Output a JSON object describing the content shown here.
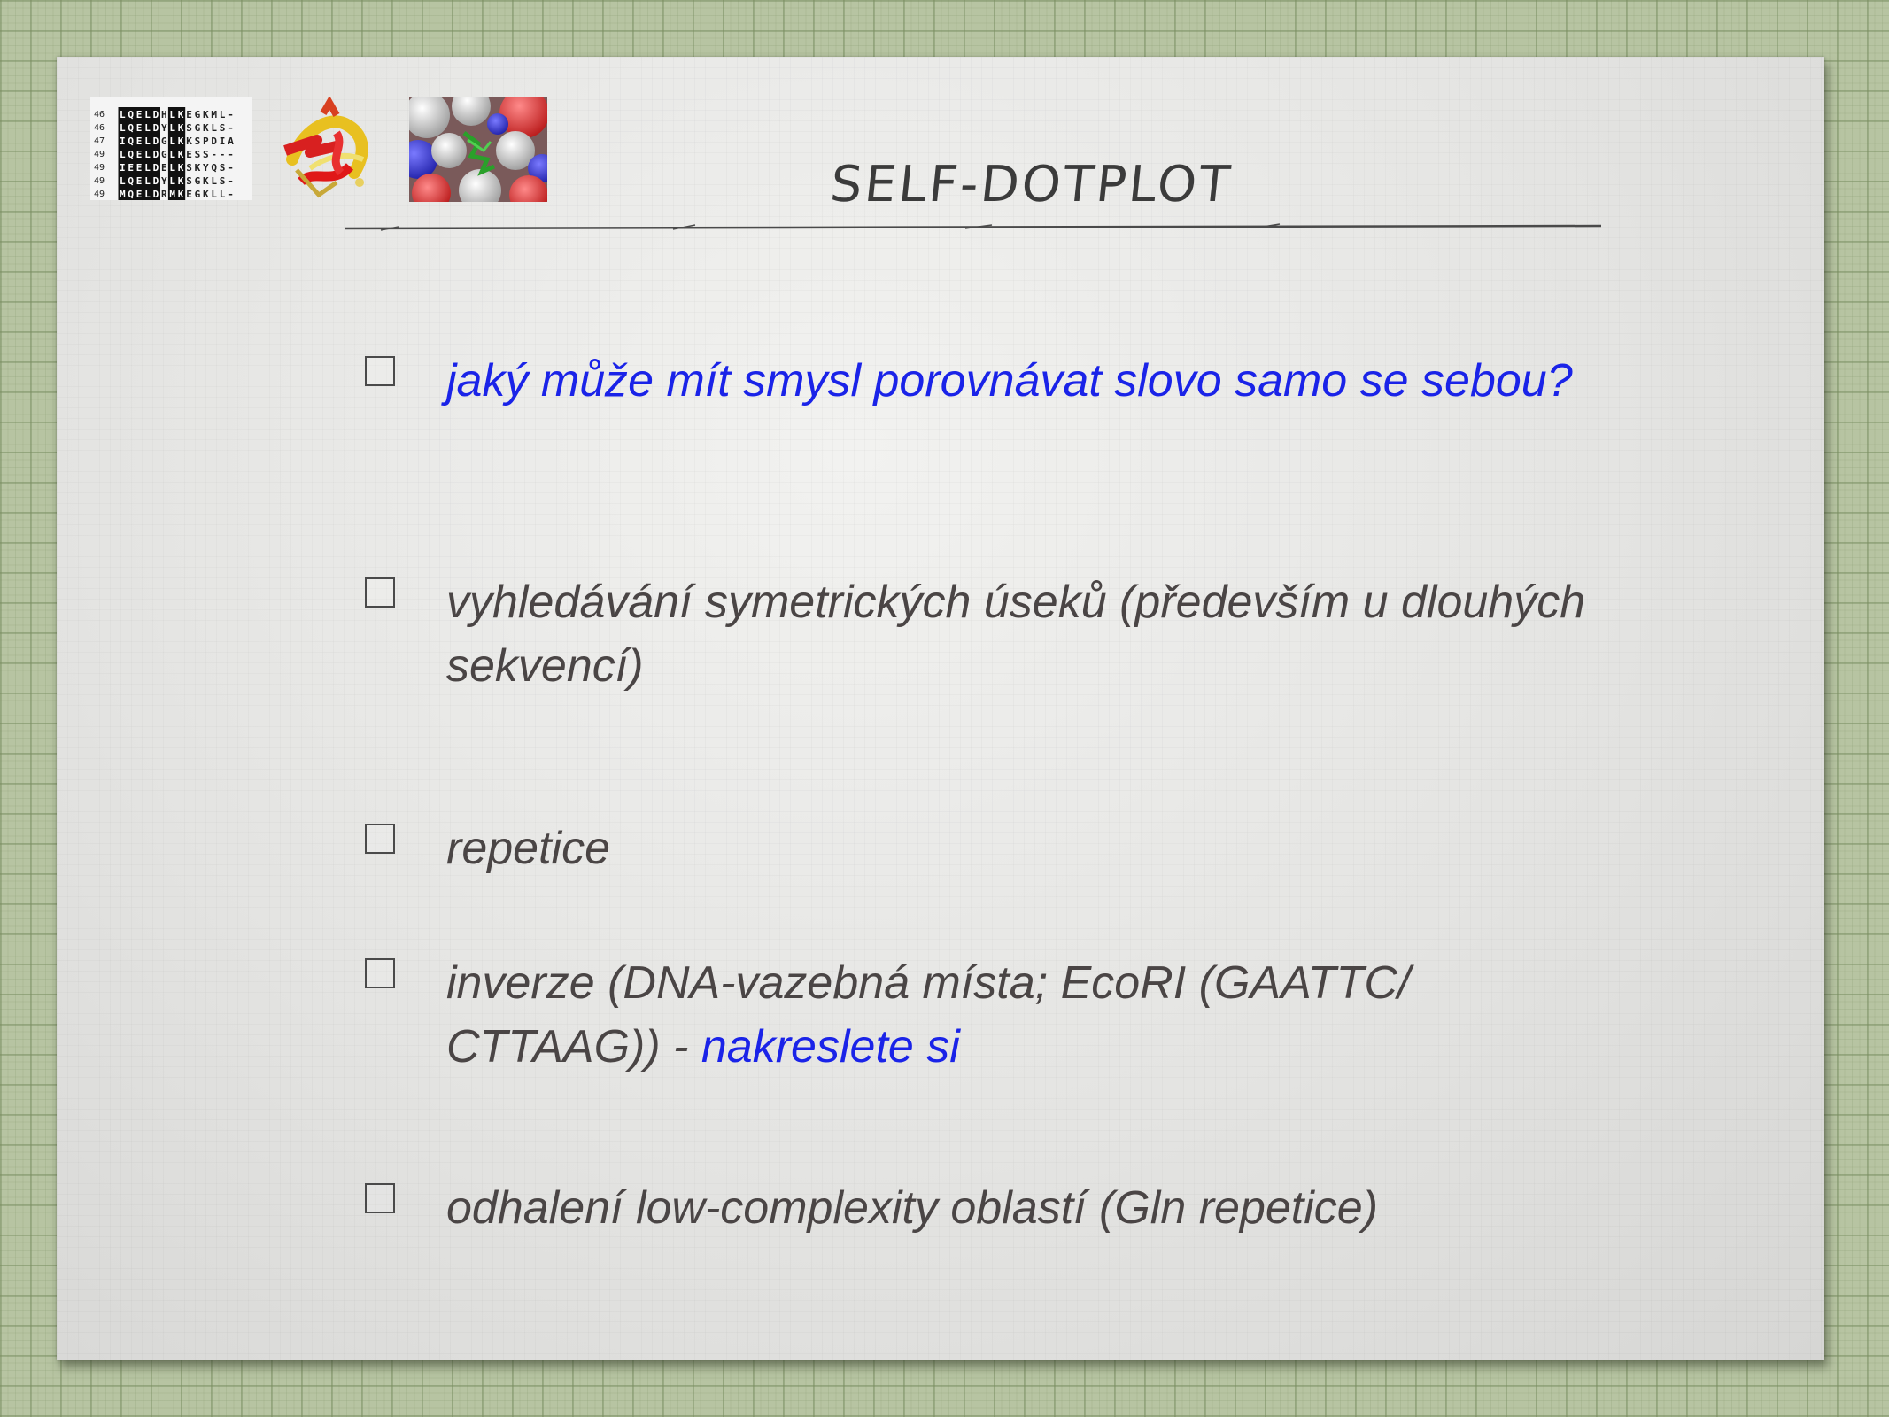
{
  "slide": {
    "title": "SELF-DOTPLOT",
    "logos": {
      "alignment_lines": [
        {
          "num": "46",
          "seq": "LQELDHLKEGKML-"
        },
        {
          "num": "46",
          "seq": "LQELDYLKSGKLS-"
        },
        {
          "num": "47",
          "seq": "IQELDGLKKSPDIA"
        },
        {
          "num": "49",
          "seq": "LQELDGLKESS---"
        },
        {
          "num": "49",
          "seq": "IEELDELKSKYQS-"
        },
        {
          "num": "49",
          "seq": "LQELDYLKSGKLS-"
        },
        {
          "num": "49",
          "seq": "MQELDRMKEGKLL-"
        }
      ]
    },
    "items": [
      {
        "text": "jaký může mít smysl porovnávat slovo samo se sebou?"
      },
      {
        "text": "vyhledávání symetrických úseků (především u dlouhých sekvencí)"
      },
      {
        "text": " repetice"
      },
      {
        "text": "inverze (DNA-vazebná místa; EcoRI (GAATTC/ CTTAAG))  - ",
        "highlight": "nakreslete si"
      },
      {
        "text": "odhalení low-complexity oblastí (Gln repetice)"
      }
    ],
    "colors": {
      "highlight": "#1a23e8",
      "body_text": "#4a4545",
      "background": "#b7c4a2"
    }
  }
}
